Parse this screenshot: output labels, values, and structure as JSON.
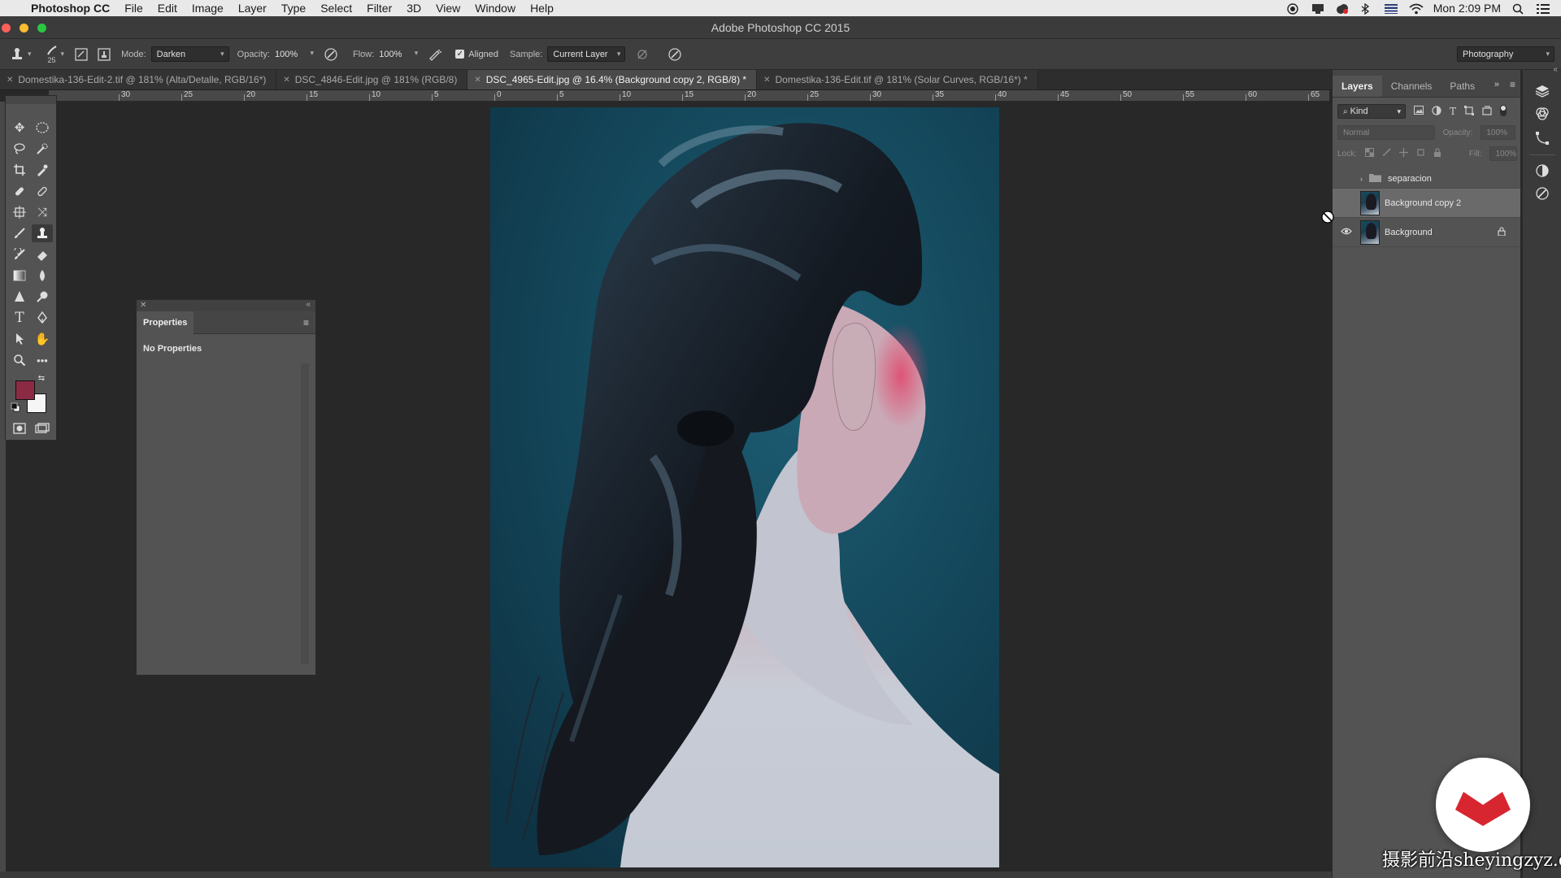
{
  "menubar": {
    "app_name": "Photoshop CC",
    "items": [
      "File",
      "Edit",
      "Image",
      "Layer",
      "Type",
      "Select",
      "Filter",
      "3D",
      "View",
      "Window",
      "Help"
    ],
    "clock": "Mon 2:09 PM"
  },
  "window": {
    "title": "Adobe Photoshop CC 2015"
  },
  "options": {
    "brush_size": "25",
    "mode_label": "Mode:",
    "mode_value": "Darken",
    "opacity_label": "Opacity:",
    "opacity_value": "100%",
    "flow_label": "Flow:",
    "flow_value": "100%",
    "aligned_label": "Aligned",
    "sample_label": "Sample:",
    "sample_value": "Current Layer",
    "workspace": "Photography"
  },
  "tabs": [
    {
      "label": "Domestika-136-Edit-2.tif @ 181% (Alta/Detalle, RGB/16*)"
    },
    {
      "label": "DSC_4846-Edit.jpg @ 181% (RGB/8)"
    },
    {
      "label": "DSC_4965-Edit.jpg @ 16.4% (Background copy 2, RGB/8) *"
    },
    {
      "label": "Domestika-136-Edit.tif @ 181% (Solar Curves, RGB/16*) *"
    }
  ],
  "ruler_labels": [
    "30",
    "25",
    "20",
    "15",
    "10",
    "5",
    "0",
    "5",
    "10",
    "15",
    "20",
    "25",
    "30",
    "35",
    "40",
    "45",
    "50",
    "55",
    "60",
    "65"
  ],
  "properties": {
    "title": "Properties",
    "body": "No Properties"
  },
  "layers_panel": {
    "tabs": [
      "Layers",
      "Channels",
      "Paths"
    ],
    "kind_label": "Kind",
    "blend_mode": "Normal",
    "opacity_label": "Opacity:",
    "opacity_value": "100%",
    "lock_label": "Lock:",
    "fill_label": "Fill:",
    "fill_value": "100%",
    "layers": [
      {
        "name": "separacion",
        "type": "group",
        "visible": false,
        "selected": false
      },
      {
        "name": "Background copy 2",
        "type": "pixel",
        "visible": false,
        "selected": true
      },
      {
        "name": "Background",
        "type": "pixel",
        "visible": true,
        "selected": false,
        "locked": true
      }
    ]
  },
  "watermark": {
    "text": "摄影前沿sheyingzyz.com"
  },
  "colors": {
    "foreground": "#8a2a43",
    "background": "#f5f5f5",
    "photo_backdrop": "#15495d",
    "watermark_red": "#d7262f"
  },
  "icons": {
    "tools": [
      "move-icon",
      "marquee-icon",
      "lasso-icon",
      "quick-select-icon",
      "crop-icon",
      "eyedropper-icon",
      "healing-icon",
      "patch-icon",
      "brush-icon",
      "clone-stamp-icon",
      "history-brush-icon",
      "eraser-icon",
      "gradient-icon",
      "blur-icon",
      "dodge-icon",
      "sharpen-icon",
      "type-icon",
      "pen-icon",
      "path-select-icon",
      "hand-icon",
      "zoom-icon",
      "more-tools-icon",
      "quick-mask-icon",
      "screen-mode-icon"
    ]
  }
}
